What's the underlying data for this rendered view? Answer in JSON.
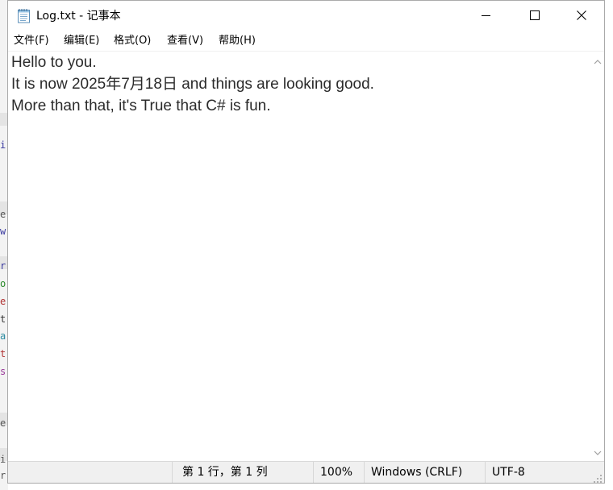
{
  "window": {
    "title": "Log.txt - 记事本"
  },
  "menu": {
    "items": [
      {
        "label": "文件(F)"
      },
      {
        "label": "编辑(E)"
      },
      {
        "label": "格式(O)"
      },
      {
        "label": "查看(V)"
      },
      {
        "label": "帮助(H)"
      }
    ]
  },
  "editor": {
    "lines": [
      "Hello to you.",
      "It is now 2025年7月18日 and things are looking good.",
      "More than that, it's True that C# is fun."
    ]
  },
  "status": {
    "position": "第 1 行，第 1 列",
    "zoom": "100%",
    "line_ending": "Windows (CRLF)",
    "encoding": "UTF-8"
  },
  "icons": {
    "app": "notepad-icon",
    "minimize": "minimize-icon",
    "maximize": "maximize-icon",
    "close": "close-icon",
    "scroll_up": "chevron-up-icon",
    "scroll_down": "chevron-down-icon",
    "resize": "resize-grip-icon"
  },
  "background_editor": {
    "fragments": [
      "i",
      "e",
      "w",
      "r",
      "o",
      "e",
      "t",
      "a",
      "t",
      "s",
      "e",
      "i",
      "r",
      "()"
    ]
  }
}
